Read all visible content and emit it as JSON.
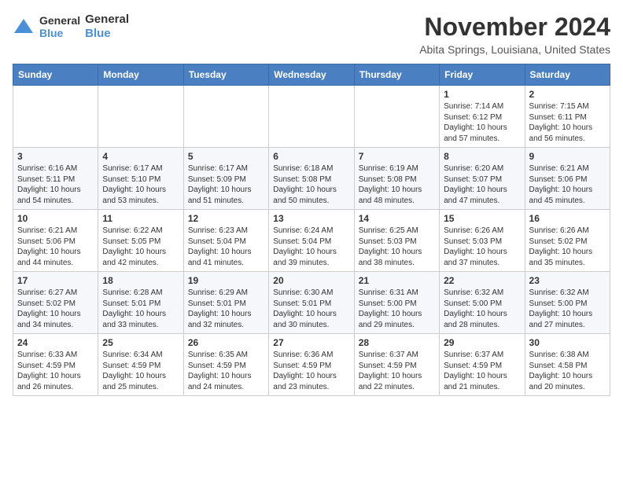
{
  "header": {
    "logo_line1": "General",
    "logo_line2": "Blue",
    "month": "November 2024",
    "location": "Abita Springs, Louisiana, United States"
  },
  "days_of_week": [
    "Sunday",
    "Monday",
    "Tuesday",
    "Wednesday",
    "Thursday",
    "Friday",
    "Saturday"
  ],
  "weeks": [
    [
      {
        "day": "",
        "info": ""
      },
      {
        "day": "",
        "info": ""
      },
      {
        "day": "",
        "info": ""
      },
      {
        "day": "",
        "info": ""
      },
      {
        "day": "",
        "info": ""
      },
      {
        "day": "1",
        "info": "Sunrise: 7:14 AM\nSunset: 6:12 PM\nDaylight: 10 hours and 57 minutes."
      },
      {
        "day": "2",
        "info": "Sunrise: 7:15 AM\nSunset: 6:11 PM\nDaylight: 10 hours and 56 minutes."
      }
    ],
    [
      {
        "day": "3",
        "info": "Sunrise: 6:16 AM\nSunset: 5:11 PM\nDaylight: 10 hours and 54 minutes."
      },
      {
        "day": "4",
        "info": "Sunrise: 6:17 AM\nSunset: 5:10 PM\nDaylight: 10 hours and 53 minutes."
      },
      {
        "day": "5",
        "info": "Sunrise: 6:17 AM\nSunset: 5:09 PM\nDaylight: 10 hours and 51 minutes."
      },
      {
        "day": "6",
        "info": "Sunrise: 6:18 AM\nSunset: 5:08 PM\nDaylight: 10 hours and 50 minutes."
      },
      {
        "day": "7",
        "info": "Sunrise: 6:19 AM\nSunset: 5:08 PM\nDaylight: 10 hours and 48 minutes."
      },
      {
        "day": "8",
        "info": "Sunrise: 6:20 AM\nSunset: 5:07 PM\nDaylight: 10 hours and 47 minutes."
      },
      {
        "day": "9",
        "info": "Sunrise: 6:21 AM\nSunset: 5:06 PM\nDaylight: 10 hours and 45 minutes."
      }
    ],
    [
      {
        "day": "10",
        "info": "Sunrise: 6:21 AM\nSunset: 5:06 PM\nDaylight: 10 hours and 44 minutes."
      },
      {
        "day": "11",
        "info": "Sunrise: 6:22 AM\nSunset: 5:05 PM\nDaylight: 10 hours and 42 minutes."
      },
      {
        "day": "12",
        "info": "Sunrise: 6:23 AM\nSunset: 5:04 PM\nDaylight: 10 hours and 41 minutes."
      },
      {
        "day": "13",
        "info": "Sunrise: 6:24 AM\nSunset: 5:04 PM\nDaylight: 10 hours and 39 minutes."
      },
      {
        "day": "14",
        "info": "Sunrise: 6:25 AM\nSunset: 5:03 PM\nDaylight: 10 hours and 38 minutes."
      },
      {
        "day": "15",
        "info": "Sunrise: 6:26 AM\nSunset: 5:03 PM\nDaylight: 10 hours and 37 minutes."
      },
      {
        "day": "16",
        "info": "Sunrise: 6:26 AM\nSunset: 5:02 PM\nDaylight: 10 hours and 35 minutes."
      }
    ],
    [
      {
        "day": "17",
        "info": "Sunrise: 6:27 AM\nSunset: 5:02 PM\nDaylight: 10 hours and 34 minutes."
      },
      {
        "day": "18",
        "info": "Sunrise: 6:28 AM\nSunset: 5:01 PM\nDaylight: 10 hours and 33 minutes."
      },
      {
        "day": "19",
        "info": "Sunrise: 6:29 AM\nSunset: 5:01 PM\nDaylight: 10 hours and 32 minutes."
      },
      {
        "day": "20",
        "info": "Sunrise: 6:30 AM\nSunset: 5:01 PM\nDaylight: 10 hours and 30 minutes."
      },
      {
        "day": "21",
        "info": "Sunrise: 6:31 AM\nSunset: 5:00 PM\nDaylight: 10 hours and 29 minutes."
      },
      {
        "day": "22",
        "info": "Sunrise: 6:32 AM\nSunset: 5:00 PM\nDaylight: 10 hours and 28 minutes."
      },
      {
        "day": "23",
        "info": "Sunrise: 6:32 AM\nSunset: 5:00 PM\nDaylight: 10 hours and 27 minutes."
      }
    ],
    [
      {
        "day": "24",
        "info": "Sunrise: 6:33 AM\nSunset: 4:59 PM\nDaylight: 10 hours and 26 minutes."
      },
      {
        "day": "25",
        "info": "Sunrise: 6:34 AM\nSunset: 4:59 PM\nDaylight: 10 hours and 25 minutes."
      },
      {
        "day": "26",
        "info": "Sunrise: 6:35 AM\nSunset: 4:59 PM\nDaylight: 10 hours and 24 minutes."
      },
      {
        "day": "27",
        "info": "Sunrise: 6:36 AM\nSunset: 4:59 PM\nDaylight: 10 hours and 23 minutes."
      },
      {
        "day": "28",
        "info": "Sunrise: 6:37 AM\nSunset: 4:59 PM\nDaylight: 10 hours and 22 minutes."
      },
      {
        "day": "29",
        "info": "Sunrise: 6:37 AM\nSunset: 4:59 PM\nDaylight: 10 hours and 21 minutes."
      },
      {
        "day": "30",
        "info": "Sunrise: 6:38 AM\nSunset: 4:58 PM\nDaylight: 10 hours and 20 minutes."
      }
    ]
  ]
}
